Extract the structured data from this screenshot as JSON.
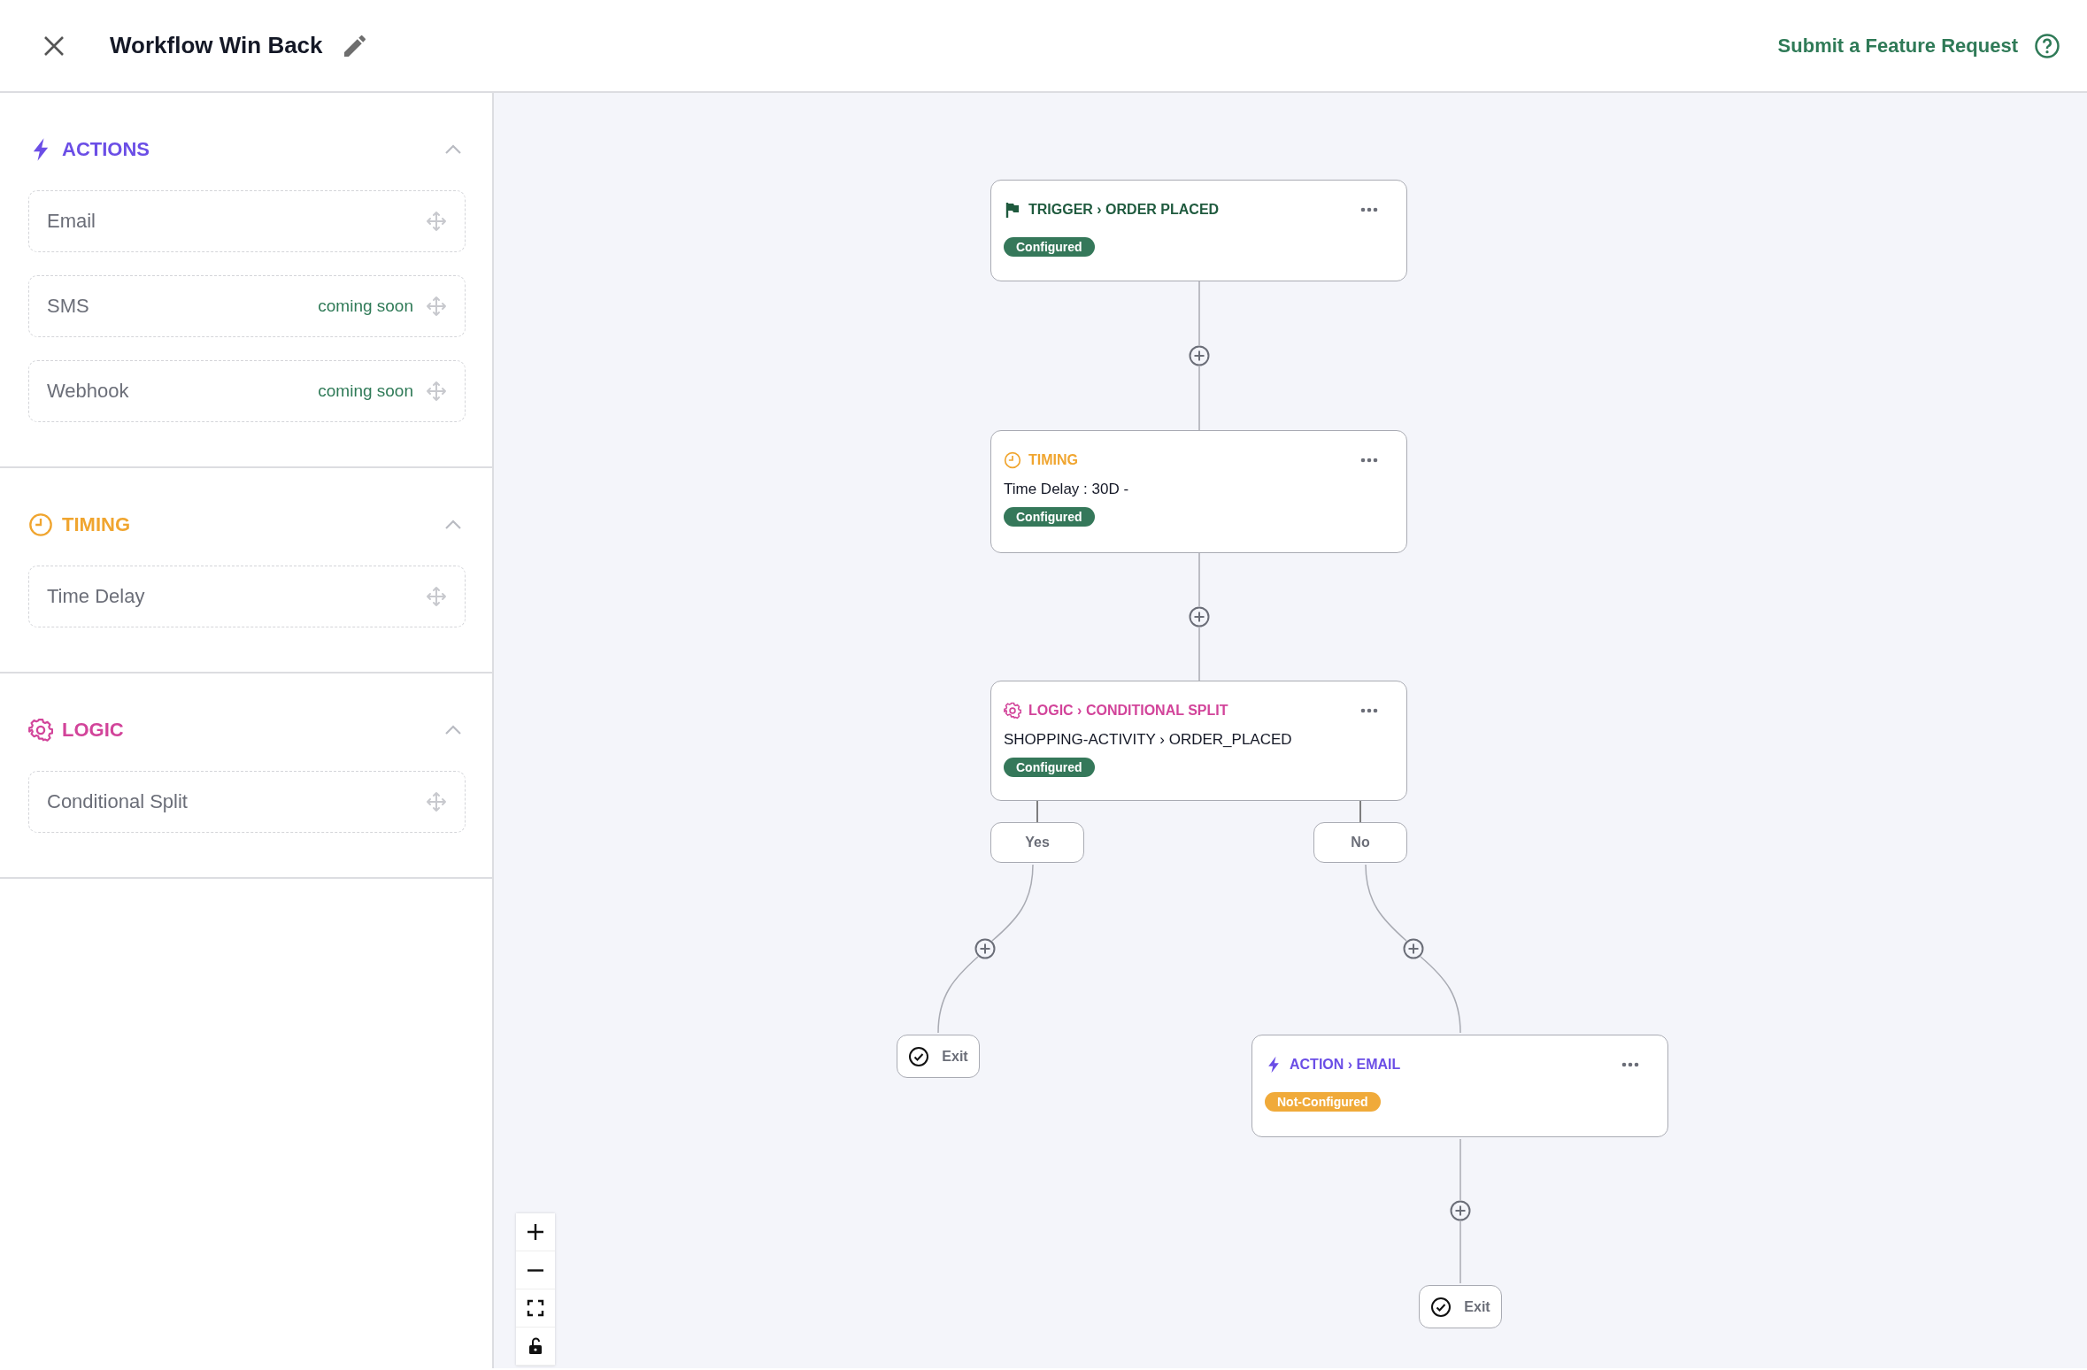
{
  "header": {
    "title": "Workflow Win Back",
    "link": "Submit a Feature Request"
  },
  "sidebar": {
    "sections": [
      {
        "kind": "actions",
        "title": "ACTIONS",
        "expanded": true,
        "items": [
          {
            "label": "Email"
          },
          {
            "label": "SMS",
            "note": "coming soon"
          },
          {
            "label": "Webhook",
            "note": "coming soon"
          }
        ]
      },
      {
        "kind": "timing",
        "title": "TIMING",
        "expanded": true,
        "items": [
          {
            "label": "Time Delay"
          }
        ]
      },
      {
        "kind": "logic",
        "title": "LOGIC",
        "expanded": true,
        "items": [
          {
            "label": "Conditional Split"
          }
        ]
      }
    ]
  },
  "canvas": {
    "nodes": [
      {
        "kind": "trigger",
        "title": "TRIGGER › ORDER PLACED",
        "status": "Configured",
        "configured": true
      },
      {
        "kind": "timing",
        "title": "TIMING",
        "detail": "Time Delay : 30D -",
        "status": "Configured",
        "configured": true
      },
      {
        "kind": "logic",
        "title": "LOGIC › CONDITIONAL SPLIT",
        "detail": "SHOPPING-ACTIVITY › ORDER_PLACED",
        "status": "Configured",
        "configured": true
      },
      {
        "kind": "action",
        "title": "ACTION › EMAIL",
        "status": "Not-Configured",
        "configured": false
      }
    ],
    "branches": [
      {
        "label": "Yes"
      },
      {
        "label": "No"
      }
    ],
    "exits": [
      {
        "label": "Exit"
      },
      {
        "label": "Exit"
      }
    ]
  }
}
